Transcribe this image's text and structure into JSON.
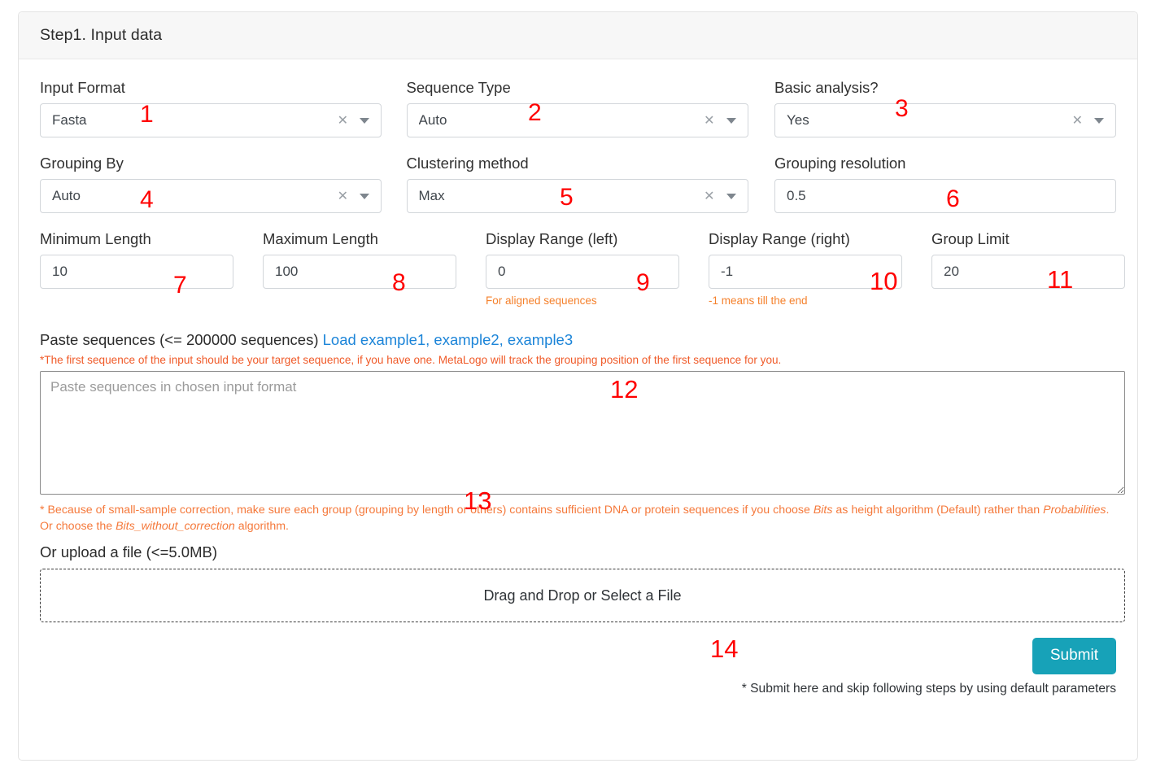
{
  "card": {
    "header_title": "Step1. Input data"
  },
  "fields": {
    "input_format": {
      "label": "Input Format",
      "value": "Fasta",
      "clear_icon": "close-icon",
      "caret_icon": "chevron-down-icon"
    },
    "sequence_type": {
      "label": "Sequence Type",
      "value": "Auto",
      "clear_icon": "close-icon",
      "caret_icon": "chevron-down-icon"
    },
    "basic_analysis": {
      "label": "Basic analysis?",
      "value": "Yes",
      "clear_icon": "close-icon",
      "caret_icon": "chevron-down-icon"
    },
    "grouping_by": {
      "label": "Grouping By",
      "value": "Auto",
      "clear_icon": "close-icon",
      "caret_icon": "chevron-down-icon"
    },
    "clustering_method": {
      "label": "Clustering method",
      "value": "Max",
      "clear_icon": "close-icon",
      "caret_icon": "chevron-down-icon"
    },
    "grouping_resolution": {
      "label": "Grouping resolution",
      "value": "0.5"
    },
    "minimum_length": {
      "label": "Minimum Length",
      "value": "10"
    },
    "maximum_length": {
      "label": "Maximum Length",
      "value": "100"
    },
    "display_range_left": {
      "label": "Display Range (left)",
      "value": "0",
      "hint": "For aligned sequences"
    },
    "display_range_right": {
      "label": "Display Range (right)",
      "value": "-1",
      "hint": "-1 means till the end"
    },
    "group_limit": {
      "label": "Group Limit",
      "value": "20"
    }
  },
  "paste": {
    "title": "Paste sequences (<= 200000 sequences)",
    "load_links": "Load example1, example2, example3",
    "note": "*The first sequence of the input should be your target sequence, if you have one. MetaLogo will track the grouping position of the first sequence for you.",
    "placeholder": "Paste sequences in chosen input format",
    "value": ""
  },
  "small_note": {
    "part1": "* Because of small-sample correction, make sure each group (grouping by length or others) contains sufficient DNA or protein sequences if you choose ",
    "em1": "Bits",
    "part2": " as height algorithm (Default) rather than ",
    "em2": "Probabilities",
    "part3": ". Or choose the ",
    "em3": "Bits_without_correction",
    "part4": " algorithm."
  },
  "upload": {
    "title": "Or upload a file (<=5.0MB)",
    "dropzone_label": "Drag and Drop or Select a File"
  },
  "submit": {
    "label": "Submit",
    "note": "* Submit here and skip following steps by using default parameters",
    "color": "#17a2b8"
  },
  "annotations": {
    "n1": "1",
    "n2": "2",
    "n3": "3",
    "n4": "4",
    "n5": "5",
    "n6": "6",
    "n7": "7",
    "n8": "8",
    "n9": "9",
    "n10": "10",
    "n11": "11",
    "n12": "12",
    "n13": "13",
    "n14": "14"
  }
}
